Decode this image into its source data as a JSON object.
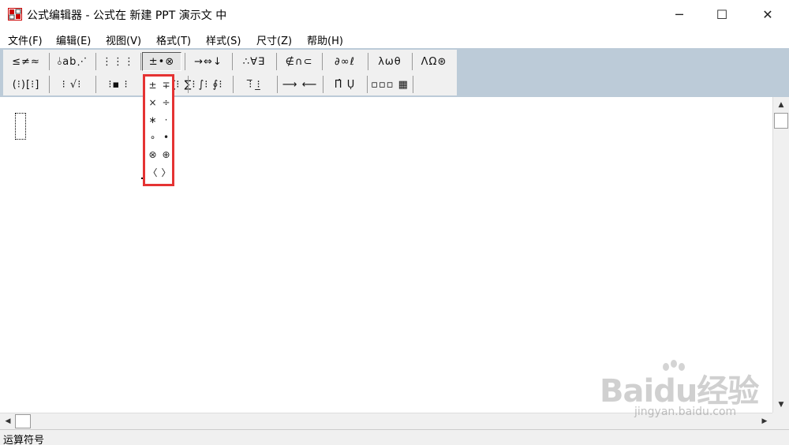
{
  "window": {
    "title": "公式编辑器 - 公式在 新建 PPT 演示文 中",
    "minimize_glyph": "─",
    "maximize_glyph": "☐",
    "close_glyph": "✕"
  },
  "menu": [
    {
      "label": "文件(F)"
    },
    {
      "label": "编辑(E)"
    },
    {
      "label": "视图(V)"
    },
    {
      "label": "格式(T)"
    },
    {
      "label": "样式(S)"
    },
    {
      "label": "尺寸(Z)"
    },
    {
      "label": "帮助(H)"
    }
  ],
  "toolbar": {
    "row1": [
      {
        "label": "≤≠≈"
      },
      {
        "label": "⫰ab⋰"
      },
      {
        "label": "⋮⋮⋮"
      },
      {
        "label": "±•⊗"
      },
      {
        "label": "→⇔↓"
      },
      {
        "label": "∴∀∃"
      },
      {
        "label": "∉∩⊂"
      },
      {
        "label": "∂∞ℓ"
      },
      {
        "label": "λωθ"
      },
      {
        "label": "ΛΩ⊛"
      }
    ],
    "row2": [
      {
        "label": "(⁝)[⁝]"
      },
      {
        "label": "⁝ √⁝"
      },
      {
        "label": "⁝▪ ⁝"
      },
      {
        "label": "∑⁝ ∑⁝"
      },
      {
        "label": "∫⁝ ∮⁝"
      },
      {
        "label": "⁝̅ ⁝̲"
      },
      {
        "label": "⟶ ⟵"
      },
      {
        "label": "Π̂ Ụ"
      },
      {
        "label": "▫▫▫ ▦"
      }
    ]
  },
  "palette": {
    "rows": [
      [
        "±",
        "∓"
      ],
      [
        "×",
        "÷"
      ],
      [
        "∗",
        "·"
      ],
      [
        "∘",
        "•"
      ],
      [
        "⊗",
        "⊕"
      ],
      [
        "〈",
        "〉"
      ]
    ]
  },
  "scroll": {
    "up_glyph": "▲",
    "down_glyph": "▼",
    "left_glyph": "◀",
    "right_glyph": "▶"
  },
  "status": {
    "text": "运算符号"
  },
  "watermark": {
    "brand": "Baidu经验",
    "url": "jingyan.baidu.com"
  }
}
